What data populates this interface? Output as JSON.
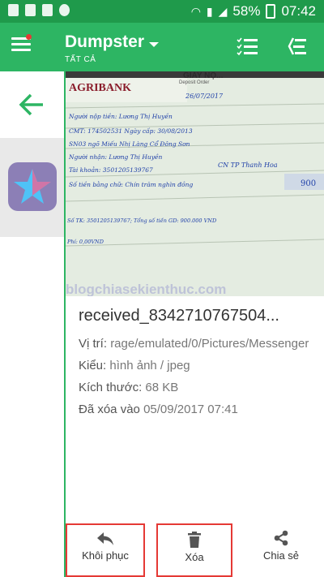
{
  "status_bar": {
    "battery": "58%",
    "time": "07:42"
  },
  "app_bar": {
    "title": "Dumpster",
    "subtitle": "TẤT CẢ"
  },
  "preview_doc": {
    "bank": "AGRIBANK",
    "form_title": "GIAY NỘ...",
    "form_subtitle": "Deposit Order",
    "date_val": "26/07/2017",
    "lines": [
      "Người nộp tiền: Lương Thị Huyền",
      "CMT: 174502531   Ngày cấp: 30/08/2013",
      "SN03 ngõ Miếu Nhị Làng Cổ Đông Sơn",
      "Người nhận: Lương Thị Huyền",
      "Tài khoản: 3501205139767",
      "Số tiền bằng chữ: Chín trăm nghìn đồng",
      "Số TK: 3501205139767; Tổng số tiền GD: 900.000 VND",
      "Phí: 0,00VND"
    ],
    "issue_place": "CN TP Thanh Hoa",
    "amount": "900",
    "watermark": "blogchiasekienthuc.com"
  },
  "file": {
    "name": "received_8342710767504...",
    "location_label": "Vị trí:",
    "location_value": "rage/emulated/0/Pictures/Messenger",
    "type_label": "Kiểu:",
    "type_value": "hình ảnh / jpeg",
    "size_label": "Kích thước:",
    "size_value": "68 KB",
    "deleted_label": "Đã xóa vào",
    "deleted_value": "05/09/2017 07:41"
  },
  "actions": {
    "restore": "Khôi phục",
    "delete": "Xóa",
    "share": "Chia sẻ"
  },
  "colors": {
    "status_bar": "#1f9a4b",
    "app_bar": "#2db563",
    "highlight": "#e53935"
  }
}
